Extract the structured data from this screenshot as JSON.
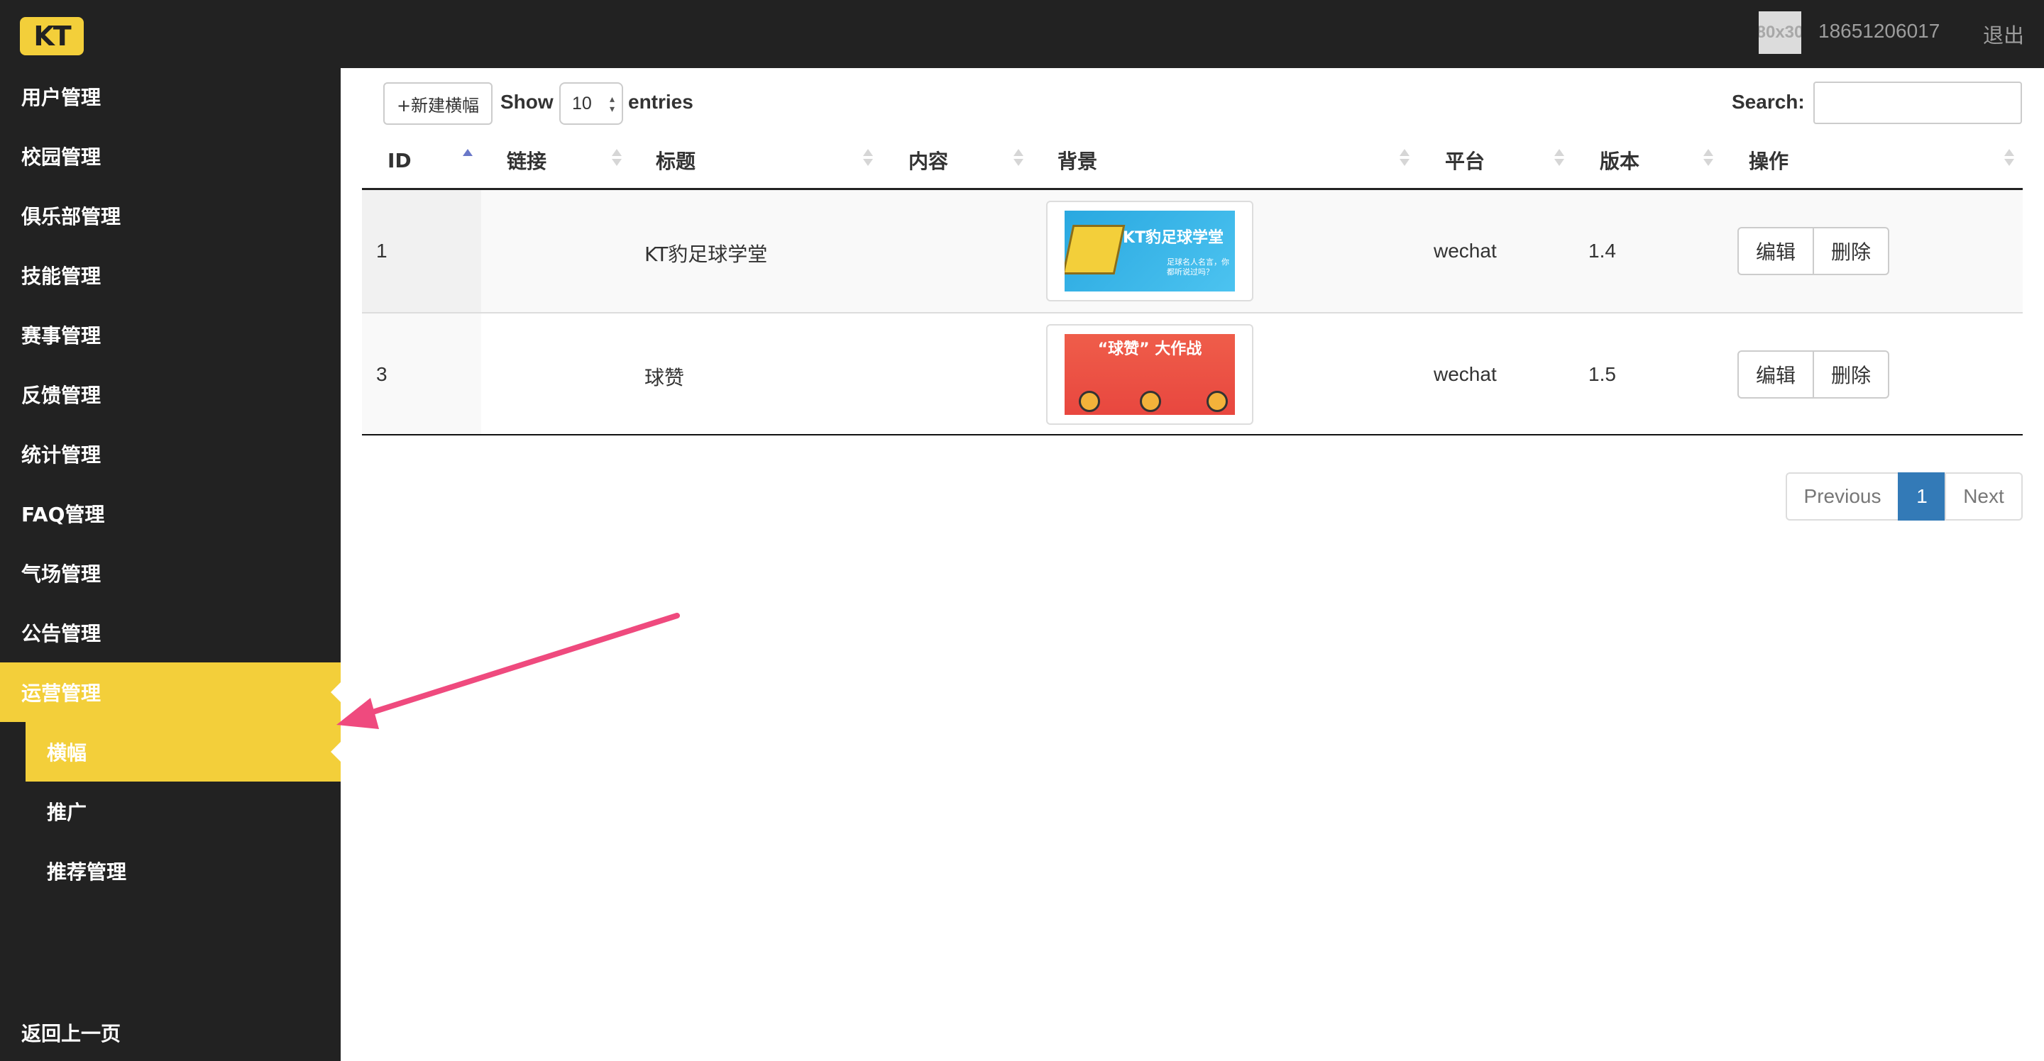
{
  "header": {
    "avatar_placeholder": "80x30",
    "phone": "18651206017",
    "logout_label": "退出",
    "logo_text": "KT"
  },
  "sidebar": {
    "items": [
      {
        "label": "用户管理"
      },
      {
        "label": "校园管理"
      },
      {
        "label": "俱乐部管理"
      },
      {
        "label": "技能管理"
      },
      {
        "label": "赛事管理"
      },
      {
        "label": "反馈管理"
      },
      {
        "label": "统计管理"
      },
      {
        "label": "FAQ管理"
      },
      {
        "label": "气场管理"
      },
      {
        "label": "公告管理"
      },
      {
        "label": "运营管理",
        "active": true
      }
    ],
    "subitems": [
      {
        "label": "横幅",
        "active": true
      },
      {
        "label": "推广"
      },
      {
        "label": "推荐管理"
      }
    ],
    "back_label": "返回上一页"
  },
  "toolbar": {
    "new_banner_label": "+新建横幅",
    "show_label": "Show",
    "page_size": "10",
    "entries_label": "entries",
    "search_label": "Search:",
    "search_value": ""
  },
  "table": {
    "columns": [
      "ID",
      "链接",
      "标题",
      "内容",
      "背景",
      "平台",
      "版本",
      "操作"
    ],
    "sort_column": "ID",
    "sort_direction": "asc",
    "rows": [
      {
        "id": "1",
        "link": "",
        "title": "KT豹足球学堂",
        "content": "",
        "background_text": "KT豹足球学堂",
        "background_subtext": "足球名人名言，你都听说过吗？",
        "platform": "wechat",
        "version": "1.4",
        "edit_label": "编辑",
        "delete_label": "删除"
      },
      {
        "id": "3",
        "link": "",
        "title": "球赞",
        "content": "",
        "background_text": "“球赞” 大作战",
        "platform": "wechat",
        "version": "1.5",
        "edit_label": "编辑",
        "delete_label": "删除"
      }
    ]
  },
  "pagination": {
    "previous_label": "Previous",
    "current_page": "1",
    "next_label": "Next"
  },
  "colors": {
    "accent": "#f3cf3a",
    "dark": "#222222",
    "page_active": "#337ab7",
    "annotation_arrow": "#ef4a7e"
  }
}
